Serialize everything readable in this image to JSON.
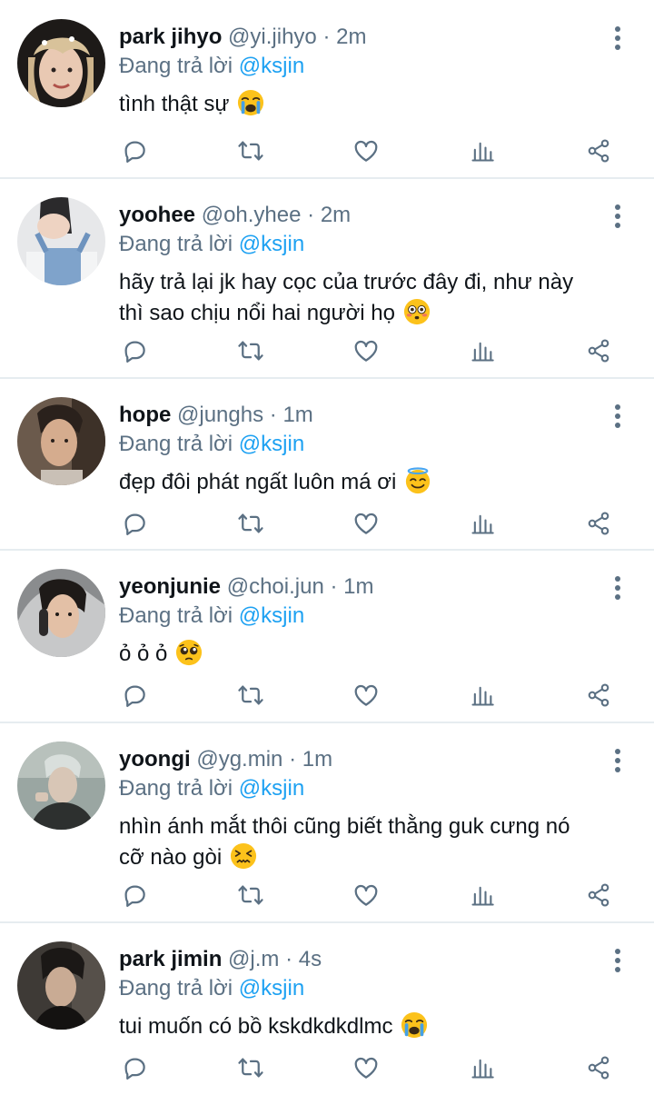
{
  "tweets": [
    {
      "name": "park jihyo",
      "handle": "@yi.jihyo",
      "separator": "·",
      "time": "2m",
      "reply_prefix": "Đang trả lời",
      "reply_to": "@ksjin",
      "text": "tình thật sự",
      "emoji": "loudly-crying-face"
    },
    {
      "name": "yoohee",
      "handle": "@oh.yhee",
      "separator": "·",
      "time": "2m",
      "reply_prefix": "Đang trả lời",
      "reply_to": "@ksjin",
      "text_line1": "hãy trả lại jk hay cọc của trước đây đi, như này",
      "text_line2": "thì sao chịu nổi hai người họ",
      "emoji": "flushed-face"
    },
    {
      "name": "hope",
      "handle": "@junghs",
      "separator": "·",
      "time": "1m",
      "reply_prefix": "Đang trả lời",
      "reply_to": "@ksjin",
      "text": "đẹp đôi phát ngất luôn má ơi",
      "emoji": "smiling-face-with-halo"
    },
    {
      "name": "yeonjunie",
      "handle": "@choi.jun",
      "separator": "·",
      "time": "1m",
      "reply_prefix": "Đang trả lời",
      "reply_to": "@ksjin",
      "text": "ỏ ỏ ỏ",
      "emoji": "pleading-face"
    },
    {
      "name": "yoongi",
      "handle": "@yg.min",
      "separator": "·",
      "time": "1m",
      "reply_prefix": "Đang trả lời",
      "reply_to": "@ksjin",
      "text_line1": "nhìn ánh mắt thôi cũng biết thằng guk cưng nó",
      "text_line2": "cỡ nào gòi",
      "emoji": "confounded-face"
    },
    {
      "name": "park jimin",
      "handle": "@j.m",
      "separator": "·",
      "time": "4s",
      "reply_prefix": "Đang trả lời",
      "reply_to": "@ksjin",
      "text": "tui muốn có bồ kskdkdkdlmc",
      "emoji": "loudly-crying-face"
    }
  ],
  "colors": {
    "name": "#0f1419",
    "secondary": "#5b7083",
    "mention": "#1da1f2",
    "divider": "#e6ecf0",
    "icon": "#5b7083"
  }
}
